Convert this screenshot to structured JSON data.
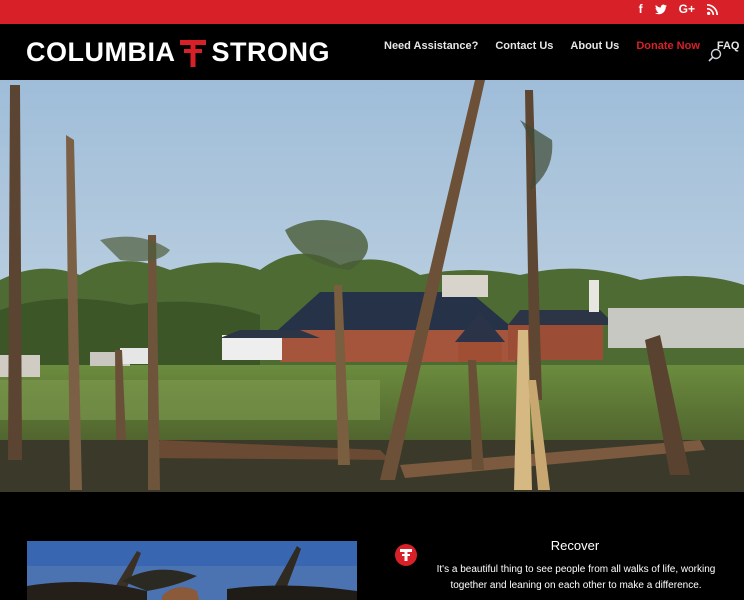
{
  "social": {
    "facebook": "f",
    "twitter": "twitter-bird",
    "google_plus": "G+",
    "rss": "rss"
  },
  "logo": {
    "left_word": "COLUMBIA",
    "right_word": "STRONG",
    "accent_color": "#d72027"
  },
  "nav": {
    "items": [
      {
        "label": "Need Assistance?"
      },
      {
        "label": "Contact Us"
      },
      {
        "label": "About Us"
      },
      {
        "label": "Donate Now"
      },
      {
        "label": "FAQ"
      }
    ]
  },
  "hero": {
    "description": "storm-damaged trees in front of a brick church"
  },
  "recover": {
    "title": "Recover",
    "text": "It's a beautiful thing to see people from all walks of life, working together and leaning on each other to make a difference."
  }
}
